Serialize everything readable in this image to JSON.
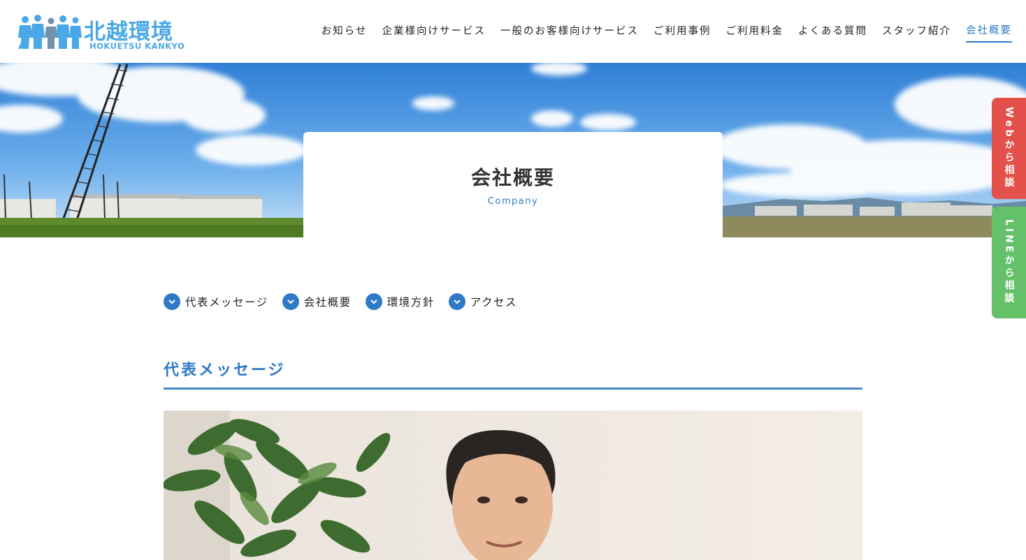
{
  "logo": {
    "title": "北越環境",
    "subtitle": "HOKUETSU KANKYO",
    "mark_icon": "people-silhouettes-icon",
    "color": "#4aa8e6"
  },
  "nav": {
    "items": [
      {
        "label": "お知らせ"
      },
      {
        "label": "企業様向けサービス"
      },
      {
        "label": "一般のお客様向けサービス"
      },
      {
        "label": "ご利用事例"
      },
      {
        "label": "ご利用料金"
      },
      {
        "label": "よくある質問"
      },
      {
        "label": "スタッフ紹介"
      },
      {
        "label": "会社概要",
        "active": true
      }
    ]
  },
  "hero": {
    "title": "会社概要",
    "subtitle": "Company"
  },
  "side_buttons": {
    "web": {
      "label": "Webから相談",
      "color": "#e4504a"
    },
    "line": {
      "label": "LINEから相談",
      "color": "#65c06a"
    }
  },
  "anchors": [
    {
      "label": "代表メッセージ",
      "icon": "chevron-down-icon"
    },
    {
      "label": "会社概要",
      "icon": "chevron-down-icon"
    },
    {
      "label": "環境方針",
      "icon": "chevron-down-icon"
    },
    {
      "label": "アクセス",
      "icon": "chevron-down-icon"
    }
  ],
  "section": {
    "title": "代表メッセージ"
  },
  "colors": {
    "accent": "#2f79c6",
    "web_button": "#e4504a",
    "line_button": "#65c06a"
  }
}
